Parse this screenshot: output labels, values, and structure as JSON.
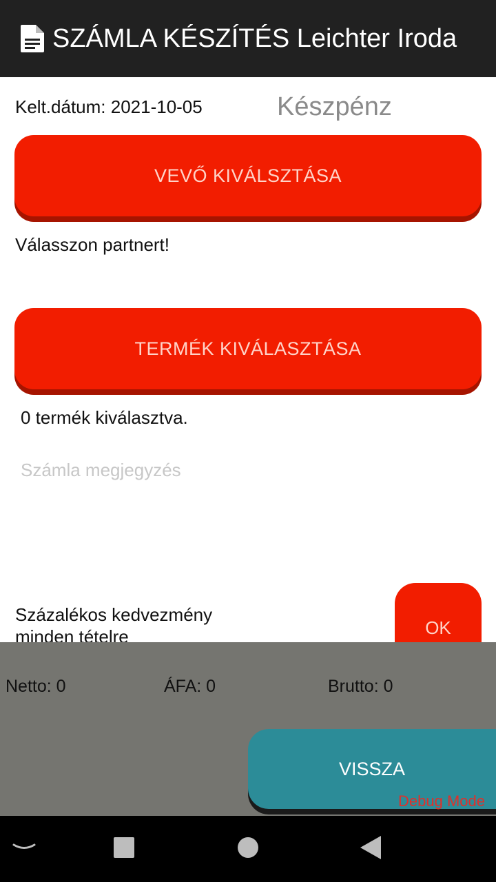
{
  "app_bar": {
    "icon": "document-icon",
    "title": "SZÁMLA KÉSZÍTÉS Leichter Iroda"
  },
  "header": {
    "date_label": "Kelt.dátum: 2021-10-05",
    "payment_method": "Készpénz"
  },
  "customer": {
    "button_label": "VEVŐ KIVÁLSZTÁSA",
    "hint": "Válasszon partnert!"
  },
  "product": {
    "button_label": "TERMÉK KIVÁLASZTÁSA",
    "count_text": "0 termék kiválasztva."
  },
  "note": {
    "placeholder": "Számla megjegyzés",
    "value": ""
  },
  "discount": {
    "label": "Százalékos kedvezmény minden tételre",
    "ok_label": "OK"
  },
  "summary": {
    "netto": "Netto: 0",
    "afa": "ÁFA: 0",
    "brutto": "Brutto: 0",
    "back_label": "VISSZA",
    "debug": "Debug Mode"
  },
  "colors": {
    "accent_red": "#f21d00",
    "accent_teal": "#2c8c98",
    "app_bar": "#212121",
    "summary_bg": "#757570"
  }
}
